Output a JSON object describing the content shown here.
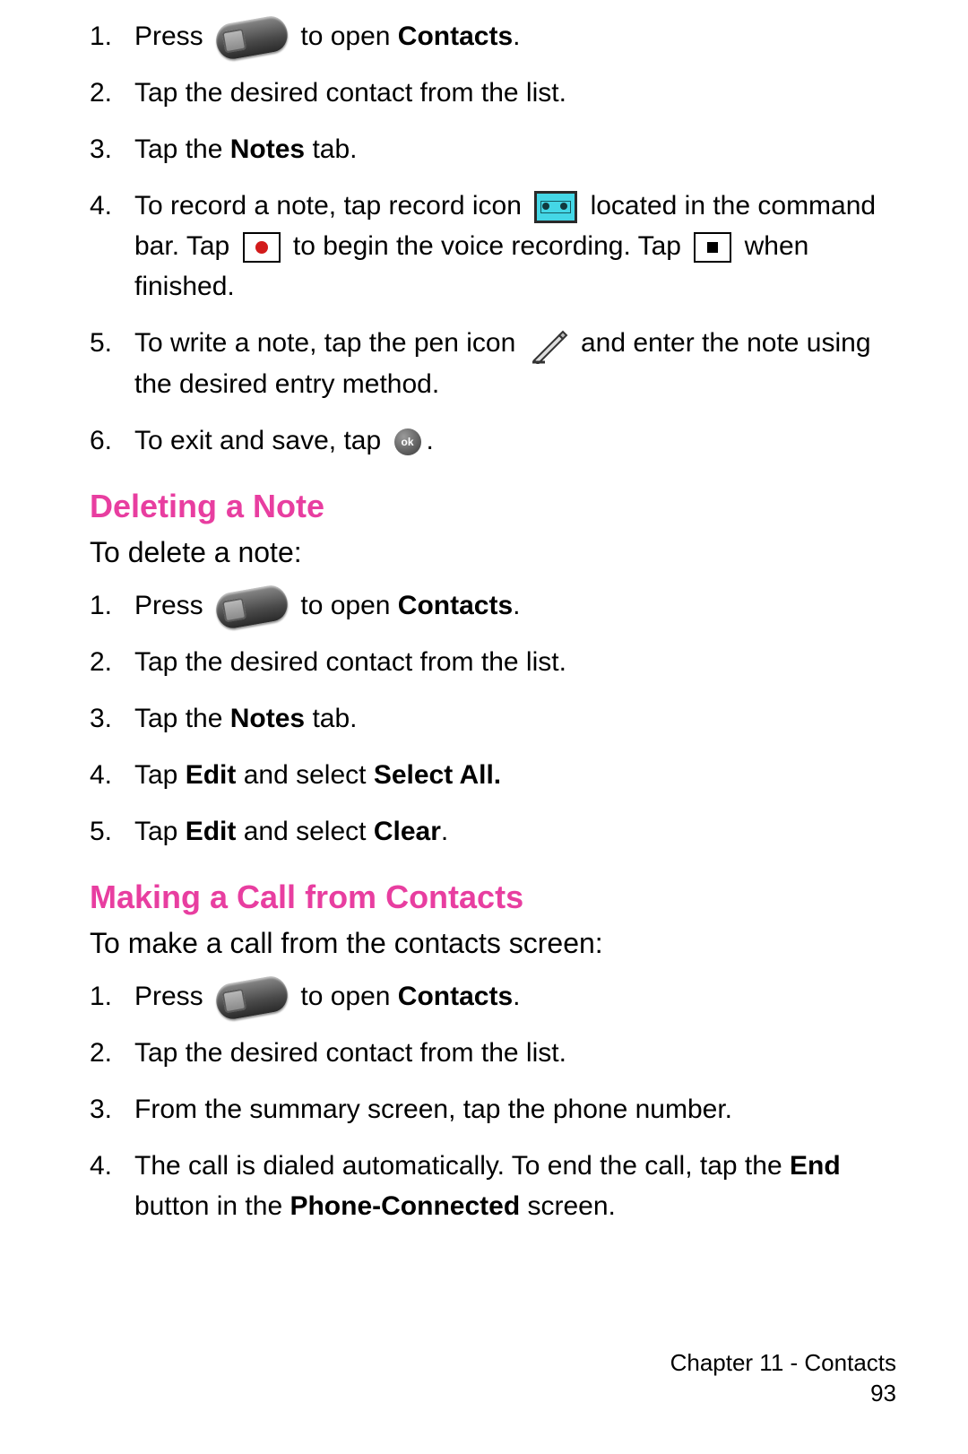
{
  "section1": {
    "items": [
      {
        "num": "1.",
        "pre": "Press ",
        "post": " to open ",
        "bold": "Contacts",
        "tail": "."
      },
      {
        "num": "2.",
        "text": "Tap the desired contact from the list."
      },
      {
        "num": "3.",
        "pre": "Tap the ",
        "bold": "Notes",
        "post": " tab."
      },
      {
        "num": "4.",
        "p4a_pre": "To record a note, tap record icon ",
        "p4a_post": " located in the command bar. Tap ",
        "p4b": " to begin the voice recording. Tap ",
        "p4c": " when finished."
      },
      {
        "num": "5.",
        "p5_pre": "To write a note, tap the pen icon ",
        "p5_post": " and enter the note using the desired entry method."
      },
      {
        "num": "6.",
        "p6_pre": "To exit and save, tap ",
        "p6_post": "."
      }
    ]
  },
  "heading1": "Deleting a Note",
  "intro1": "To delete a note:",
  "section2": {
    "items": [
      {
        "num": "1.",
        "pre": "Press ",
        "post": " to open ",
        "bold": "Contacts",
        "tail": "."
      },
      {
        "num": "2.",
        "text": "Tap the desired contact from the list."
      },
      {
        "num": "3.",
        "pre": "Tap the ",
        "bold": "Notes",
        "post": " tab."
      },
      {
        "num": "4.",
        "pre": "Tap ",
        "bold1": "Edit",
        "mid": " and select ",
        "bold2": "Select All."
      },
      {
        "num": "5.",
        "pre": "Tap ",
        "bold1": "Edit",
        "mid": " and select ",
        "bold2": "Clear",
        "tail": "."
      }
    ]
  },
  "heading2": "Making a Call from Contacts",
  "intro2": "To make a call from the contacts screen:",
  "section3": {
    "items": [
      {
        "num": "1.",
        "pre": "Press ",
        "post": " to open ",
        "bold": "Contacts",
        "tail": "."
      },
      {
        "num": "2.",
        "text": "Tap the desired contact from the list."
      },
      {
        "num": "3.",
        "text": "From the summary screen, tap the phone number."
      },
      {
        "num": "4.",
        "pre": "The call is dialed automatically. To end the call, tap the ",
        "bold1": "End",
        "mid": " button in the ",
        "bold2": "Phone-Connected",
        "tail": " screen."
      }
    ]
  },
  "footer": {
    "chapter": "Chapter 11 - Contacts",
    "page": "93"
  },
  "ok_label": "ok"
}
